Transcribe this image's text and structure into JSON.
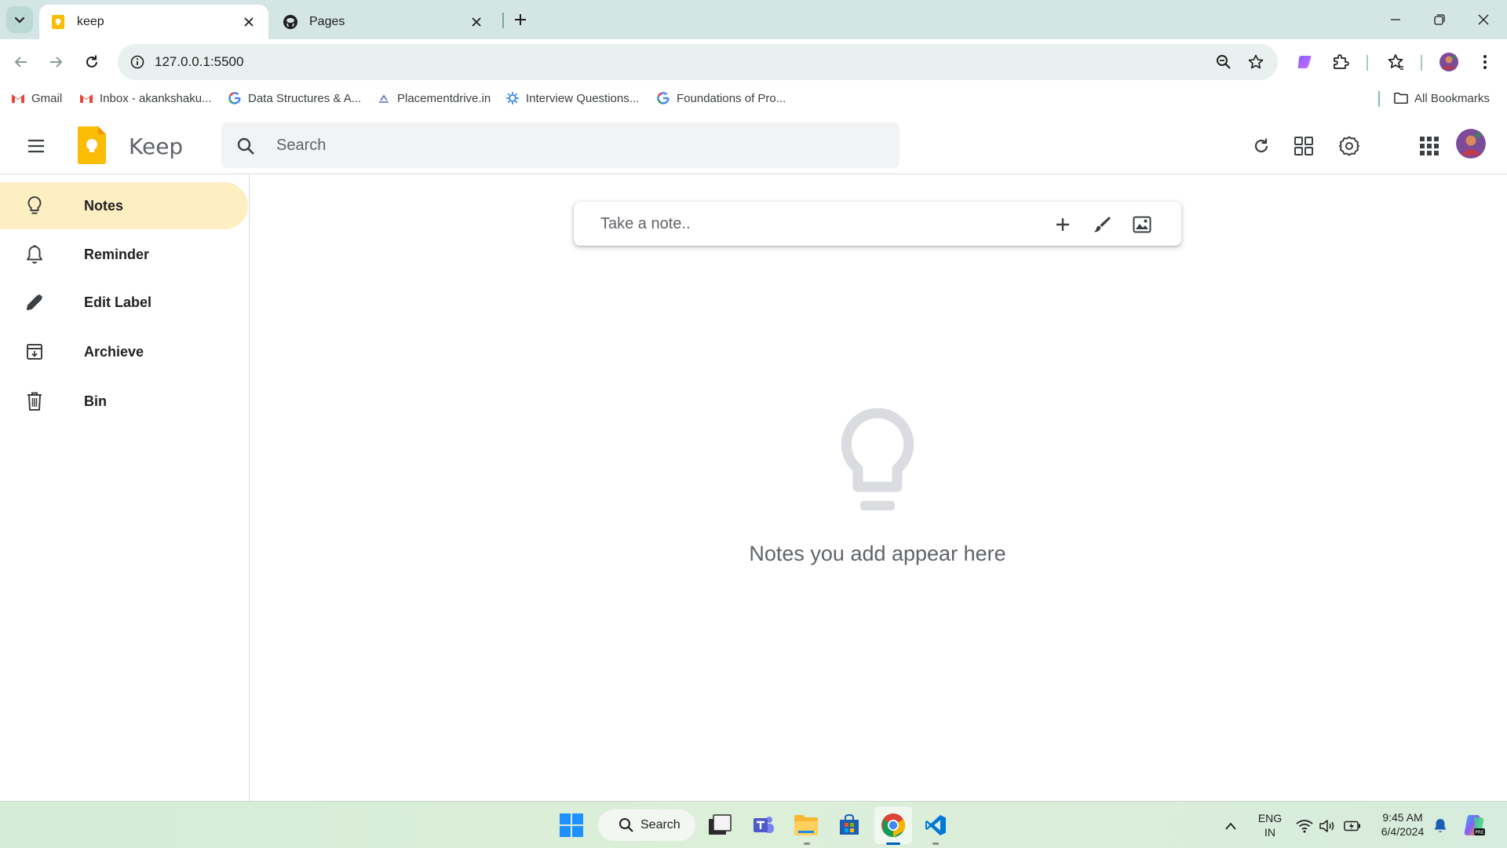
{
  "browser": {
    "tabs": [
      {
        "title": "keep",
        "favicon": "keep-favicon-icon",
        "active": true
      },
      {
        "title": "Pages",
        "favicon": "github-icon",
        "active": false
      }
    ],
    "url": "127.0.0.1:5500",
    "bookmarks": [
      {
        "label": "Gmail",
        "icon": "gmail-icon"
      },
      {
        "label": "Inbox - akankshaku...",
        "icon": "gmail-icon"
      },
      {
        "label": "Data Structures & A...",
        "icon": "google-icon"
      },
      {
        "label": "Placementdrive.in",
        "icon": "placementdrive-icon"
      },
      {
        "label": "Interview Questions...",
        "icon": "gear-sun-icon"
      },
      {
        "label": "Foundations of Pro...",
        "icon": "google-icon"
      }
    ],
    "all_bookmarks_label": "All Bookmarks"
  },
  "app": {
    "name": "Keep",
    "search_placeholder": "Search",
    "header_icons": [
      "refresh-icon",
      "grid-view-icon",
      "settings-icon",
      "apps-grid-icon",
      "avatar"
    ]
  },
  "sidebar": {
    "items": [
      {
        "label": "Notes",
        "icon": "lightbulb-icon",
        "active": true
      },
      {
        "label": "Reminder",
        "icon": "bell-icon",
        "active": false
      },
      {
        "label": "Edit Label",
        "icon": "pencil-icon",
        "active": false
      },
      {
        "label": "Archieve",
        "icon": "archive-icon",
        "active": false
      },
      {
        "label": "Bin",
        "icon": "trash-icon",
        "active": false
      }
    ]
  },
  "main": {
    "note_placeholder": "Take a note..",
    "note_actions": [
      "plus-icon",
      "brush-icon",
      "image-icon"
    ],
    "empty_message": "Notes you add appear here"
  },
  "taskbar": {
    "search_label": "Search",
    "lang_line1": "ENG",
    "lang_line2": "IN",
    "time": "9:45 AM",
    "date": "6/4/2024"
  },
  "colors": {
    "accent_active_nav": "#feefc3",
    "keep_yellow": "#fbbc04",
    "chrome_frame": "#d3e6e3"
  }
}
